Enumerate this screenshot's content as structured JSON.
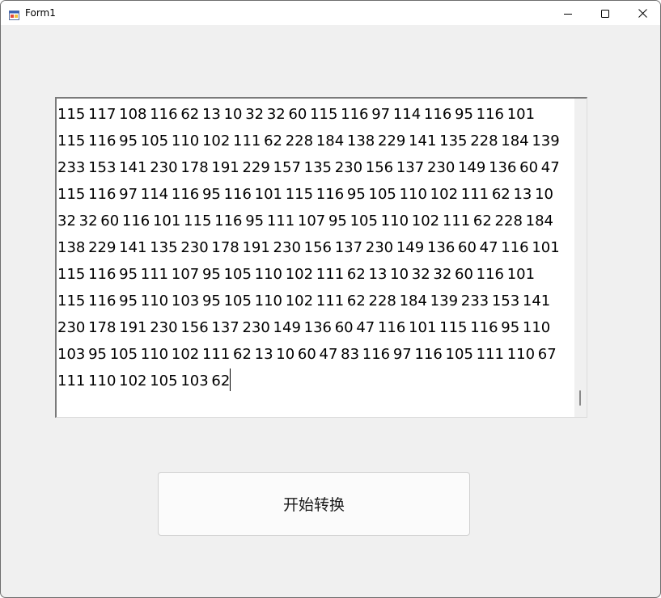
{
  "window": {
    "title": "Form1"
  },
  "textbox": {
    "value": "115 117 108 116 62 13 10 32 32 60 115 116 97 114 116 95 116 101\n115 116 95 105 110 102 111 62 228 184 138 229 141 135 228 184 139\n233 153 141 230 178 191 229 157 135 230 156 137 230 149 136 60 47\n115 116 97 114 116 95 116 101 115 116 95 105 110 102 111 62 13 10\n32 32 60 116 101 115 116 95 111 107 95 105 110 102 111 62 228 184\n138 229 141 135 230 178 191 230 156 137 230 149 136 60 47 116 101\n115 116 95 111 107 95 105 110 102 111 62 13 10 32 32 60 116 101\n115 116 95 110 103 95 105 110 102 111 62 228 184 139 233 153 141\n230 178 191 230 156 137 230 149 136 60 47 116 101 115 116 95 110\n103 95 105 110 102 111 62 13 10 60 47 83 116 97 116 105 111 110 67\n111 110 102 105 103 62"
  },
  "button": {
    "convert_label": "开始转换"
  },
  "icons": {
    "app": "form-app-icon",
    "minimize": "minimize-icon",
    "maximize": "maximize-icon",
    "close": "close-icon"
  },
  "colors": {
    "window_bg": "#f0f0f0",
    "titlebar_bg": "#ffffff",
    "textbox_bg": "#ffffff",
    "button_bg": "#fbfbfb"
  }
}
